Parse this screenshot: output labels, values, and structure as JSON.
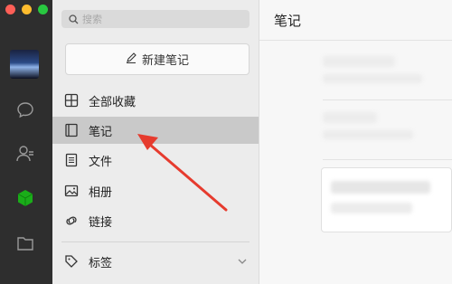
{
  "window": {
    "controls": [
      "close",
      "minimize",
      "zoom"
    ]
  },
  "rail": {
    "icons": [
      "chat-icon",
      "contacts-icon",
      "favorites-cube-icon",
      "folder-icon"
    ],
    "accent": "#1aad19"
  },
  "search": {
    "placeholder": "搜索"
  },
  "new_note_label": "新建笔记",
  "nav": {
    "items": [
      {
        "label": "全部收藏",
        "icon": "grid-icon"
      },
      {
        "label": "笔记",
        "icon": "notebook-icon",
        "active": true
      },
      {
        "label": "文件",
        "icon": "file-icon"
      },
      {
        "label": "相册",
        "icon": "photo-icon"
      },
      {
        "label": "链接",
        "icon": "link-icon"
      }
    ],
    "tags_label": "标签"
  },
  "main": {
    "title": "笔记"
  }
}
